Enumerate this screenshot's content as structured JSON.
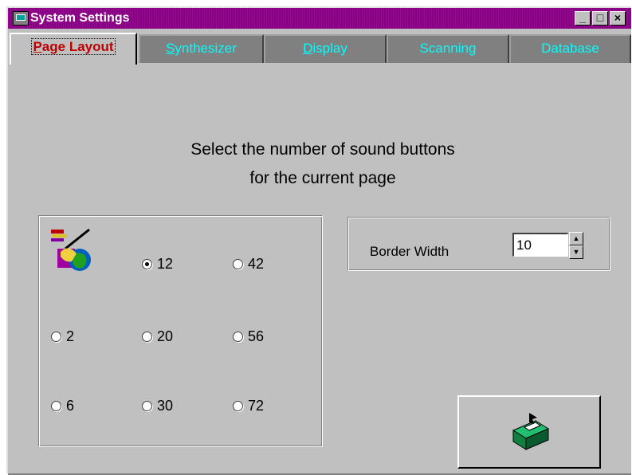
{
  "window": {
    "title": "System Settings",
    "controls": {
      "minimize": "_",
      "maximize": "□",
      "close": "×"
    }
  },
  "tabs": [
    {
      "label": "Page Layout",
      "accel": "P",
      "rest": "age Layout",
      "active": true
    },
    {
      "label": "Synthesizer",
      "accel": "S",
      "rest": "ynthesizer",
      "active": false
    },
    {
      "label": "Display",
      "accel": "D",
      "rest": "isplay",
      "active": false
    },
    {
      "label": "Scanning",
      "accel": "",
      "rest": "Scanning",
      "active": false
    },
    {
      "label": "Database",
      "accel": "",
      "rest": "Database",
      "active": false
    }
  ],
  "instruction": {
    "line1": "Select the number of sound buttons",
    "line2": "for the current page"
  },
  "sound_buttons": {
    "options": [
      "12",
      "42",
      "2",
      "20",
      "56",
      "6",
      "30",
      "72"
    ],
    "selected": "12"
  },
  "border_width": {
    "label": "Border Width",
    "value": "10"
  },
  "icons": {
    "page_icon": "page-layout-clipart-icon",
    "action_icon": "box-apply-icon",
    "spin_up": "▲",
    "spin_down": "▼"
  },
  "colors": {
    "titlebar": "#8a0085",
    "active_tab_text": "#c00000",
    "inactive_tab_text": "#00ffff",
    "inactive_tab_bg": "#808080",
    "face": "#c0c0c0"
  }
}
